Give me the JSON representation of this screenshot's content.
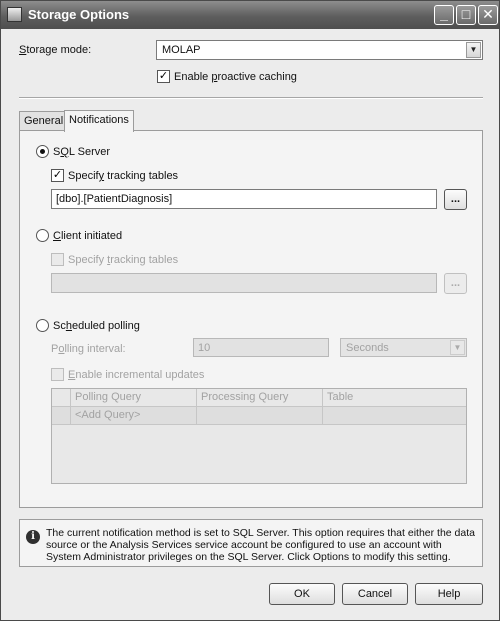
{
  "window": {
    "title": "Storage Options"
  },
  "titlebar_buttons": {
    "minimize": "_",
    "maximize": "□",
    "close": "✕"
  },
  "storage_mode": {
    "label_pre": "",
    "label_hot": "S",
    "label_post": "torage mode:",
    "value": "MOLAP"
  },
  "proactive": {
    "label_pre": "Enable ",
    "label_hot": "p",
    "label_post": "roactive caching",
    "checked": "✓"
  },
  "tabs": [
    {
      "label": "General"
    },
    {
      "label": "Notifications"
    }
  ],
  "sql_server": {
    "label_pre": "S",
    "label_hot": "Q",
    "label_post": "L Server"
  },
  "specify_tracking_1": {
    "label_pre": "Specif",
    "label_hot": "y",
    "label_post": " tracking tables",
    "checked": "✓",
    "value": "[dbo].[PatientDiagnosis]"
  },
  "client_initiated": {
    "label_pre": "",
    "label_hot": "C",
    "label_post": "lient initiated"
  },
  "specify_tracking_2": {
    "label_pre": "Specify ",
    "label_hot": "t",
    "label_post": "racking tables",
    "value": ""
  },
  "scheduled_polling": {
    "label_pre": "Sc",
    "label_hot": "h",
    "label_post": "eduled polling"
  },
  "polling": {
    "label_pre": "P",
    "label_hot": "o",
    "label_post": "lling interval:",
    "value": "10",
    "unit": "Seconds"
  },
  "incremental": {
    "label_pre": "",
    "label_hot": "E",
    "label_post": "nable incremental updates"
  },
  "grid": {
    "columns": [
      "Polling Query",
      "Processing Query",
      "Table"
    ],
    "rows": [
      [
        "<Add Query>",
        "",
        ""
      ]
    ]
  },
  "browse_label": "...",
  "info": {
    "icon": "i",
    "text": "The current notification method is set to SQL Server. This option requires that either the data source or the Analysis Services service account be configured to use an account with System Administrator privileges on the SQL Server. Click Options to modify this setting."
  },
  "buttons": {
    "ok": "OK",
    "cancel": "Cancel",
    "help": "Help"
  }
}
